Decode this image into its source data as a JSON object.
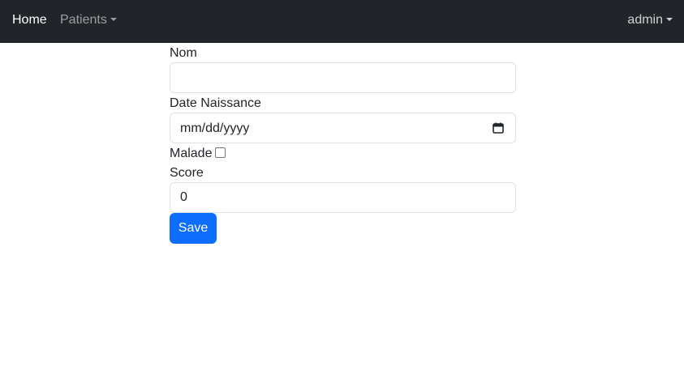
{
  "navbar": {
    "home_label": "Home",
    "patients_label": "Patients",
    "user_label": "admin"
  },
  "form": {
    "nom_label": "Nom",
    "nom_value": "",
    "date_label": "Date Naissance",
    "date_placeholder": "mm/dd/yyyy",
    "malade_label": "Malade",
    "malade_checked": false,
    "score_label": "Score",
    "score_value": "0",
    "save_label": "Save"
  },
  "colors": {
    "navbar_bg": "#212529",
    "primary": "#0d6efd"
  },
  "icons": {
    "date_picker": "calendar-icon",
    "dropdown": "caret-down-icon"
  }
}
